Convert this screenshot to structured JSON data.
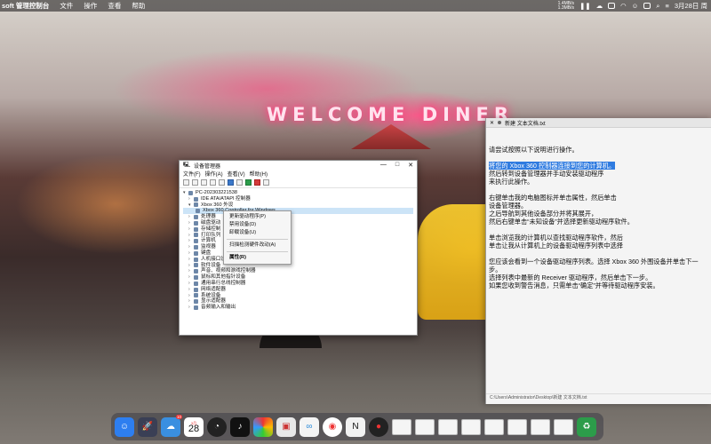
{
  "menubar": {
    "app_name": "soft 管理控制台",
    "items": [
      "文件",
      "操作",
      "查看",
      "帮助"
    ],
    "net_up": "1.4MB/s",
    "net_down": "1.3MB/s",
    "date": "3月28日 周"
  },
  "wallpaper": {
    "neon_text": "WELCOME DINER"
  },
  "device_manager": {
    "title": "设备管理器",
    "window_controls": [
      "—",
      "□",
      "✕"
    ],
    "menu": [
      "文件(F)",
      "操作(A)",
      "查看(V)",
      "帮助(H)"
    ],
    "tree": {
      "root": "PC-202303221538",
      "nodes": [
        {
          "label": "IDE ATA/ATAPI 控制器",
          "level": 1,
          "expanded": false
        },
        {
          "label": "Xbox 360 外设",
          "level": 1,
          "expanded": true
        },
        {
          "label": "Xbox 360 Controller for Windows",
          "level": 2,
          "selected": true
        },
        {
          "label": "处理器",
          "level": 1
        },
        {
          "label": "磁盘驱动",
          "level": 1
        },
        {
          "label": "存储控制",
          "level": 1
        },
        {
          "label": "打印队列",
          "level": 1
        },
        {
          "label": "计算机",
          "level": 1
        },
        {
          "label": "监视器",
          "level": 1
        },
        {
          "label": "键盘",
          "level": 1
        },
        {
          "label": "人机接口设备",
          "level": 1
        },
        {
          "label": "软件设备",
          "level": 1
        },
        {
          "label": "声音、视频和游戏控制器",
          "level": 1
        },
        {
          "label": "鼠标和其他指针设备",
          "level": 1
        },
        {
          "label": "通用串行总线控制器",
          "level": 1
        },
        {
          "label": "网络适配器",
          "level": 1
        },
        {
          "label": "系统设备",
          "level": 1
        },
        {
          "label": "显示适配器",
          "level": 1
        },
        {
          "label": "音频输入和输出",
          "level": 1
        }
      ]
    },
    "context_menu": [
      {
        "label": "更新驱动程序(P)"
      },
      {
        "label": "禁用设备(D)"
      },
      {
        "label": "卸载设备(U)"
      },
      {
        "separator": true
      },
      {
        "label": "扫描检测硬件改动(A)"
      },
      {
        "separator": true
      },
      {
        "label": "属性(R)",
        "bold": true
      }
    ]
  },
  "editor": {
    "tab_title": "新建 文本文档.txt",
    "lines": {
      "p1": "请尝试按照以下说明进行操作。",
      "p2_hl": "将您的 Xbox 360 控制器连接到您的计算机。",
      "p2_a": "然后转到设备管理器并手动安装驱动程序",
      "p2_b": "来执行此操作。",
      "p3_a": "右键单击我的电脑图标并单击属性，然后单击",
      "p3_b": "设备管理器。",
      "p3_c": "之后导航到其他设备部分并将其展开，",
      "p3_d": "然后右键单击“未知设备”并选择更新驱动程序软件。",
      "p4_a": "单击浏览我的计算机以查找驱动程序软件，然后",
      "p4_b": "单击让我从计算机上的设备驱动程序列表中选择",
      "p5_a": "您应该会看到一个设备驱动程序列表。选择 Xbox 360 外围设备并单击下一步。",
      "p5_b": "选择列表中最新的 Receiver 驱动程序，然后单击下一步。",
      "p5_c": "如果您收到警告消息，只需单击“确定”并等待驱动程序安装。"
    },
    "status_path": "C:\\Users\\Administrator\\Desktop\\新建 文本文档.txt"
  },
  "dock": {
    "calendar_month": "3月",
    "calendar_day": "28",
    "weather_badge": "10",
    "notes_label": "N",
    "colors": {
      "finder": "#2d7ef0",
      "launchpad": "#3a3f55",
      "weather": "#3a8fe0",
      "clock": "#222222",
      "tiktok": "#111111",
      "chrome": "#ffffff"
    }
  }
}
